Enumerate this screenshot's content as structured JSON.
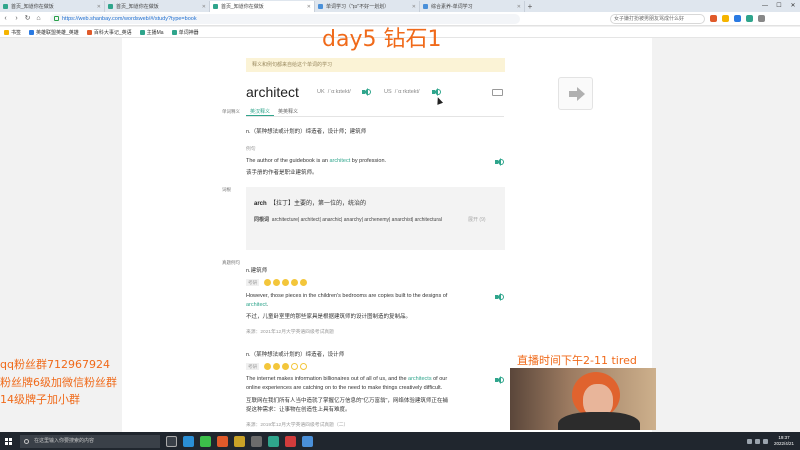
{
  "browser": {
    "tabs": [
      {
        "label": "首页_知道你在做饭",
        "color": "#2fa58c",
        "active": false
      },
      {
        "label": "首页_知道你在做饭",
        "color": "#2fa58c",
        "active": false
      },
      {
        "label": "首页_知道你在做饭",
        "color": "#2fa58c",
        "active": true
      },
      {
        "label": "单词学习（\"ɪ̯ʊ\"不好一划划）",
        "color": "#4a90d9",
        "active": false
      },
      {
        "label": "综合素养-单词学习",
        "color": "#4a90d9",
        "active": false
      }
    ],
    "url": "https://web.shanbay.com/wordsweb/#/study?type=book",
    "search_placeholder": "女子嫌打扮被男朋友骂成什么好",
    "bookmarks": [
      {
        "label": "书签",
        "color": "#f5b400"
      },
      {
        "label": "英雄联盟英雄_英雄",
        "color": "#2a7ae2"
      },
      {
        "label": "百科大事记_英语",
        "color": "#e05a2a"
      },
      {
        "label": "主播Ma",
        "color": "#2fa58c"
      },
      {
        "label": "单词神器",
        "color": "#2fa58c"
      }
    ]
  },
  "overlay": {
    "title": "day5 钻石1",
    "qq": "qq粉丝群712967924",
    "fans1": "粉丝牌6级加微信粉丝群",
    "fans2": "14级牌子加小群",
    "live": "直播时间下午2-11 tired"
  },
  "notice": "释义和例句都来自给这个单词的学习",
  "word": {
    "text": "architect",
    "uk_label": "UK",
    "uk_phon": "/ˈɑːkɪtekt/",
    "us_label": "US",
    "us_phon": "/ˈɑːrkɪtekt/"
  },
  "side_labels": {
    "definition": "单词释义",
    "etymology": "词根",
    "exam": "真题例句"
  },
  "tabs": {
    "zh": "英汉释义",
    "en": "英英释义"
  },
  "definition": {
    "meaning": "n.（某种想法或计划的）缔造者，设计师；建筑师",
    "example_label": "例句",
    "example_pre": "The author of the guidebook is an ",
    "example_word": "architect",
    "example_post": " by profession.",
    "example_zh": "该手册的作者是职业建筑师。"
  },
  "etymology": {
    "root": "arch",
    "root_gloss": "【拉丁】主要的，第一位的，统治的",
    "cognate_label": "同根词",
    "cognates": "architecture| architect| anarchic| anarchy| archenemy| anarchist| architectural",
    "expand": "展开",
    "expand_count": "(9)"
  },
  "exam": [
    {
      "sense": "n.建筑师",
      "tag": "考研",
      "rating_full": 5,
      "rating_total": 5,
      "en_line1": "However, those pieces in the children's bedrooms are copies built to the designs of",
      "en_line2_word": "architect",
      "en_line2_post": ".",
      "zh": "不过，儿童卧室里的那些家具是根据建筑师的设计图制造的复制品。",
      "source": "来源：2021年12月大学英语四级考试真题"
    },
    {
      "sense": "n.（某种想法或计划的）缔造者，设计师",
      "tag": "考研",
      "rating_full": 3,
      "rating_total": 5,
      "en_line1_pre": "The internet makes information billionaires out of all of us, and the ",
      "en_line1_word": "architects",
      "en_line1_post": " of our",
      "en_line2": "online experiences are catching on to the need to make things creatively difficult.",
      "zh1": "互联网在我们所有人当中造就了掌握亿万信息的\"亿万富翁\"，网络体验建筑师正在捕",
      "zh2": "捉这种需求：让事物在创造性上具有难度。",
      "source": "来源：2019年12月大学英语四级考试真题（二）"
    }
  ],
  "taskbar": {
    "search": "在这里输入你要搜索的内容",
    "time": "19:37",
    "date": "2022/4/21"
  }
}
